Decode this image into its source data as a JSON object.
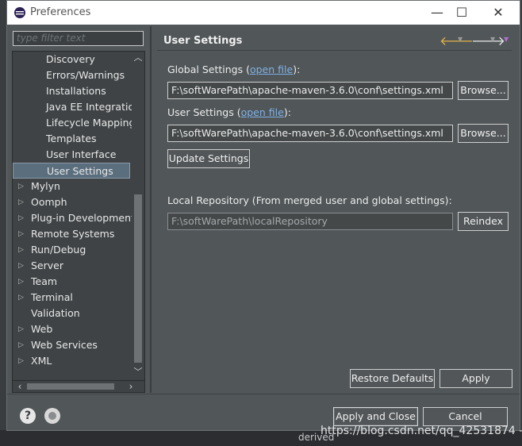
{
  "window": {
    "title": "Preferences",
    "minimize": "—",
    "maximize": "☐",
    "close": "✕"
  },
  "filter": {
    "placeholder": "type filter text"
  },
  "tree": [
    {
      "label": "Discovery",
      "level": 2,
      "expandable": false
    },
    {
      "label": "Errors/Warnings",
      "level": 2,
      "expandable": false
    },
    {
      "label": "Installations",
      "level": 2,
      "expandable": false
    },
    {
      "label": "Java EE Integration",
      "level": 2,
      "expandable": false
    },
    {
      "label": "Lifecycle Mappings",
      "level": 2,
      "expandable": false
    },
    {
      "label": "Templates",
      "level": 2,
      "expandable": false
    },
    {
      "label": "User Interface",
      "level": 2,
      "expandable": false
    },
    {
      "label": "User Settings",
      "level": 2,
      "expandable": false,
      "selected": true
    },
    {
      "label": "Mylyn",
      "level": 1,
      "expandable": true
    },
    {
      "label": "Oomph",
      "level": 1,
      "expandable": true
    },
    {
      "label": "Plug-in Development",
      "level": 1,
      "expandable": true
    },
    {
      "label": "Remote Systems",
      "level": 1,
      "expandable": true
    },
    {
      "label": "Run/Debug",
      "level": 1,
      "expandable": true
    },
    {
      "label": "Server",
      "level": 1,
      "expandable": true
    },
    {
      "label": "Team",
      "level": 1,
      "expandable": true
    },
    {
      "label": "Terminal",
      "level": 1,
      "expandable": true
    },
    {
      "label": "Validation",
      "level": 1,
      "expandable": false
    },
    {
      "label": "Web",
      "level": 1,
      "expandable": true
    },
    {
      "label": "Web Services",
      "level": 1,
      "expandable": true
    },
    {
      "label": "XML",
      "level": 1,
      "expandable": true
    }
  ],
  "page": {
    "title": "User Settings",
    "global_settings_label": "Global Settings (",
    "global_settings_link": "open file",
    "global_settings_suffix": "):",
    "global_settings_value": "F:\\softWarePath\\apache-maven-3.6.0\\conf\\settings.xml",
    "browse_label": "Browse...",
    "user_settings_label": "User Settings (",
    "user_settings_link": "open file",
    "user_settings_suffix": "):",
    "user_settings_value": "F:\\softWarePath\\apache-maven-3.6.0\\conf\\settings.xml",
    "update_settings_label": "Update Settings",
    "local_repo_label": "Local Repository (From merged user and global settings):",
    "local_repo_value": "F:\\softWarePath\\localRepository",
    "reindex_label": "Reindex",
    "restore_defaults_label": "Restore Defaults",
    "apply_label": "Apply"
  },
  "footer": {
    "help_icon": "?",
    "apply_close_label": "Apply and Close",
    "cancel_label": "Cancel"
  },
  "background": {
    "derived": "derived",
    "watermark": "https://blog.csdn.net/qq_42531874 -"
  }
}
